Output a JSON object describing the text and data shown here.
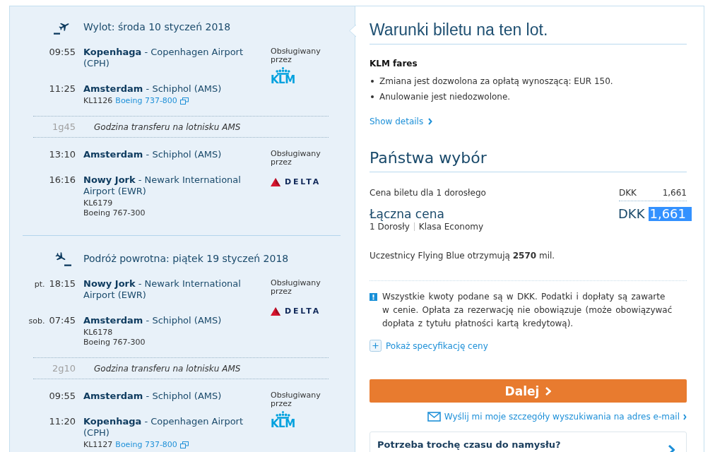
{
  "itinerary": [
    {
      "kind": "outbound",
      "title": "Wylot: środa 10 styczeń 2018",
      "items": [
        {
          "kind": "flight",
          "departure": {
            "time": "09:55",
            "place": "**Kopenhaga** - Copenhagen Airport (CPH)"
          },
          "arrival": {
            "time": "11:25",
            "place": "**Amsterdam** - Schiphol (AMS)"
          },
          "flight_number": "KL1126",
          "aircraft": "Boeing 737-800",
          "aircraft_link": true,
          "operated_by": "Obsługiwany przez",
          "carrier": {
            "kind": "klm",
            "name": "KLM"
          }
        },
        {
          "kind": "transfer",
          "duration": "1g45",
          "text": "Godzina transferu na lotnisku AMS"
        },
        {
          "kind": "flight",
          "departure": {
            "time": "13:10",
            "place": "**Amsterdam** - Schiphol (AMS)"
          },
          "arrival": {
            "time": "16:16",
            "place": "**Nowy Jork** - Newark International Airport (EWR)"
          },
          "flight_number": "KL6179",
          "aircraft": "Boeing 767-300",
          "aircraft_link": false,
          "operated_by": "Obsługiwany przez",
          "carrier": {
            "kind": "delta",
            "name": "DELTA"
          }
        }
      ]
    },
    {
      "kind": "return",
      "title": "Podróż powrotna: piątek 19 styczeń 2018",
      "items": [
        {
          "kind": "flight",
          "departure": {
            "day": "pt.",
            "time": "18:15",
            "place": "**Nowy Jork** - Newark International Airport (EWR)"
          },
          "arrival": {
            "day": "sob.",
            "time": "07:45",
            "place": "**Amsterdam** - Schiphol (AMS)"
          },
          "flight_number": "KL6178",
          "aircraft": "Boeing 767-300",
          "aircraft_link": false,
          "operated_by": "Obsługiwany przez",
          "carrier": {
            "kind": "delta",
            "name": "DELTA"
          }
        },
        {
          "kind": "transfer",
          "duration": "2g10",
          "text": "Godzina transferu na lotnisku AMS"
        },
        {
          "kind": "flight",
          "departure": {
            "time": "09:55",
            "place": "**Amsterdam** - Schiphol (AMS)"
          },
          "arrival": {
            "time": "11:20",
            "place": "**Kopenhaga** - Copenhagen Airport (CPH)"
          },
          "flight_number": "KL1127",
          "aircraft": "Boeing 737-800",
          "aircraft_link": true,
          "operated_by": "Obsługiwany przez",
          "carrier": {
            "kind": "klm",
            "name": "KLM"
          }
        }
      ]
    }
  ],
  "fare_conditions": {
    "title": "Warunki biletu na ten lot.",
    "fare_name": "KLM fares",
    "rules": [
      "Zmiana jest dozwolona za opłatą wynoszącą: EUR 150.",
      "Anulowanie jest niedozwolone."
    ],
    "details_link": "Show details"
  },
  "selection": {
    "title": "Państwa wybór",
    "ticket_price": {
      "label": "Cena biletu dla 1 dorosłego",
      "currency": "DKK",
      "amount": "1,661"
    },
    "total": {
      "label": "Łączna cena",
      "currency": "DKK",
      "amount": "1,661",
      "highlighted": true
    },
    "passengers": "1 Dorosły",
    "cabin": "Klasa Economy",
    "miles_note": "Uczestnicy Flying Blue otrzymują **2570** mil.",
    "notice": "Wszystkie kwoty podane są w DKK. Podatki i dopłaty są zawarte w cenie. Opłata za rezerwację nie obowiązuje (może obowiązywać dopłata z tytułu płatności kartą kredytową).",
    "price_breakdown_link": "Pokaż specyfikację ceny",
    "continue_button": "Dalej",
    "email_link": "Wyślij mi moje szczegóły wyszukiwania na adres e-mail",
    "hold_offer": {
      "title": "Potrzeba trochę czasu do namysłu?"
    }
  }
}
